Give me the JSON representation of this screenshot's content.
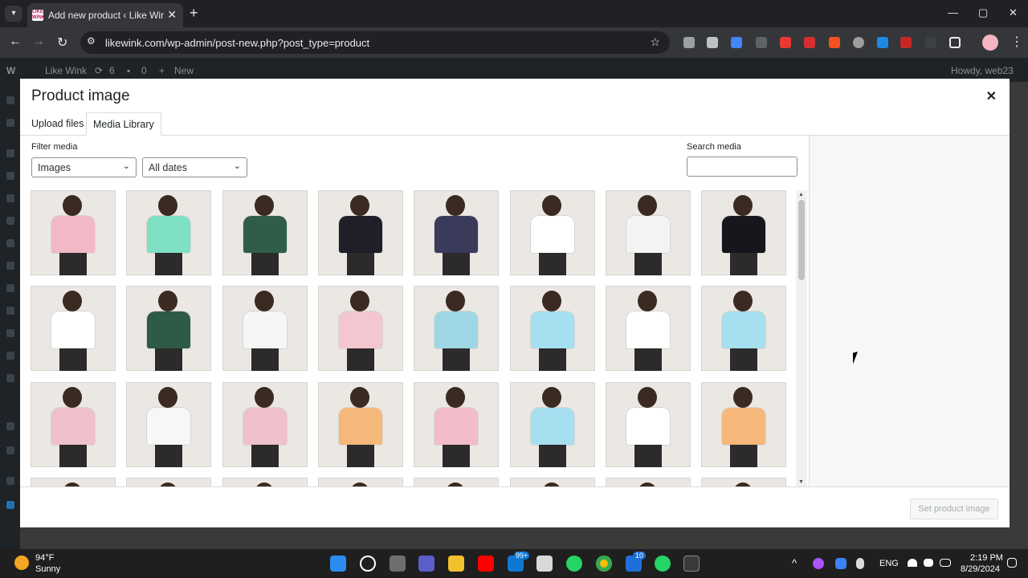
{
  "browser": {
    "tab_title": "Add new product ‹ Like Wink —",
    "favicon_text": "LIKE WINK",
    "url": "likewink.com/wp-admin/post-new.php?post_type=product",
    "new_tab": "+",
    "back": "←",
    "forward": "→",
    "reload": "↻",
    "star": "☆",
    "tab_close": "✕",
    "minimize": "—",
    "maximize": "▢",
    "window_close": "✕",
    "menu": "⋮"
  },
  "admin_bar": {
    "site_name": "Like Wink",
    "updates": "6",
    "comments": "0",
    "new_label": "New",
    "howdy": "Howdy, web23"
  },
  "modal": {
    "title": "Product image",
    "close": "✕",
    "tabs": [
      "Upload files",
      "Media Library"
    ],
    "active_tab": "Media Library",
    "filter_label": "Filter media",
    "type_select": "Images",
    "date_select": "All dates",
    "search_label": "Search media",
    "search_value": "",
    "set_button": "Set product image"
  },
  "taskbar": {
    "temperature": "94°F",
    "condition": "Sunny",
    "language": "ENG",
    "time": "2:19 PM",
    "date": "8/29/2024",
    "mail_badge": "99+",
    "store_badge": "10"
  },
  "colors": {
    "wp_dark": "#1d2327",
    "chrome_dark": "#202124",
    "chrome_toolbar": "#35363a",
    "photo_bg": "#ebe8e3"
  }
}
